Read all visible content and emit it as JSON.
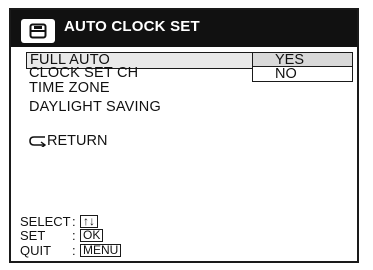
{
  "title": "AUTO CLOCK SET",
  "icon": "cassette-icon",
  "menu": {
    "items": [
      {
        "label": "FULL AUTO",
        "selected": true
      },
      {
        "label": "CLOCK SET CH",
        "selected": false
      },
      {
        "label": "TIME ZONE",
        "selected": false
      },
      {
        "label": "DAYLIGHT SAVING",
        "selected": false
      }
    ],
    "options": [
      {
        "label": "YES",
        "highlighted": true
      },
      {
        "label": "NO",
        "highlighted": false
      }
    ],
    "return_label": "RETURN",
    "return_icon": "return-arrow-icon"
  },
  "guide": {
    "select": {
      "label": "SELECT",
      "key": "↑↓"
    },
    "set": {
      "label": "SET",
      "key": "OK"
    },
    "quit": {
      "label": "QUIT",
      "key": "MENU"
    }
  }
}
